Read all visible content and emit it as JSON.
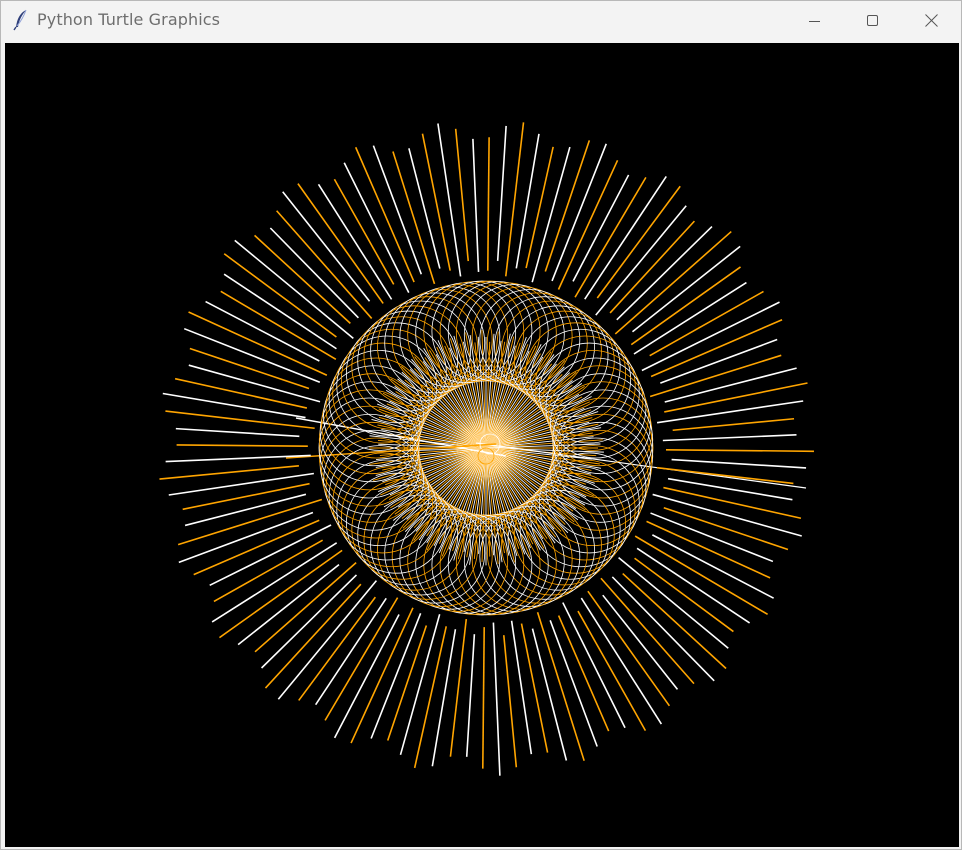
{
  "window": {
    "title": "Python Turtle Graphics",
    "icons": {
      "app": "feather-icon",
      "minimize": "minimize-icon",
      "maximize": "maximize-icon",
      "close": "close-icon"
    }
  },
  "canvas": {
    "background": "#000000",
    "pen_colors": [
      "#ffa500",
      "#ffffff"
    ]
  }
}
